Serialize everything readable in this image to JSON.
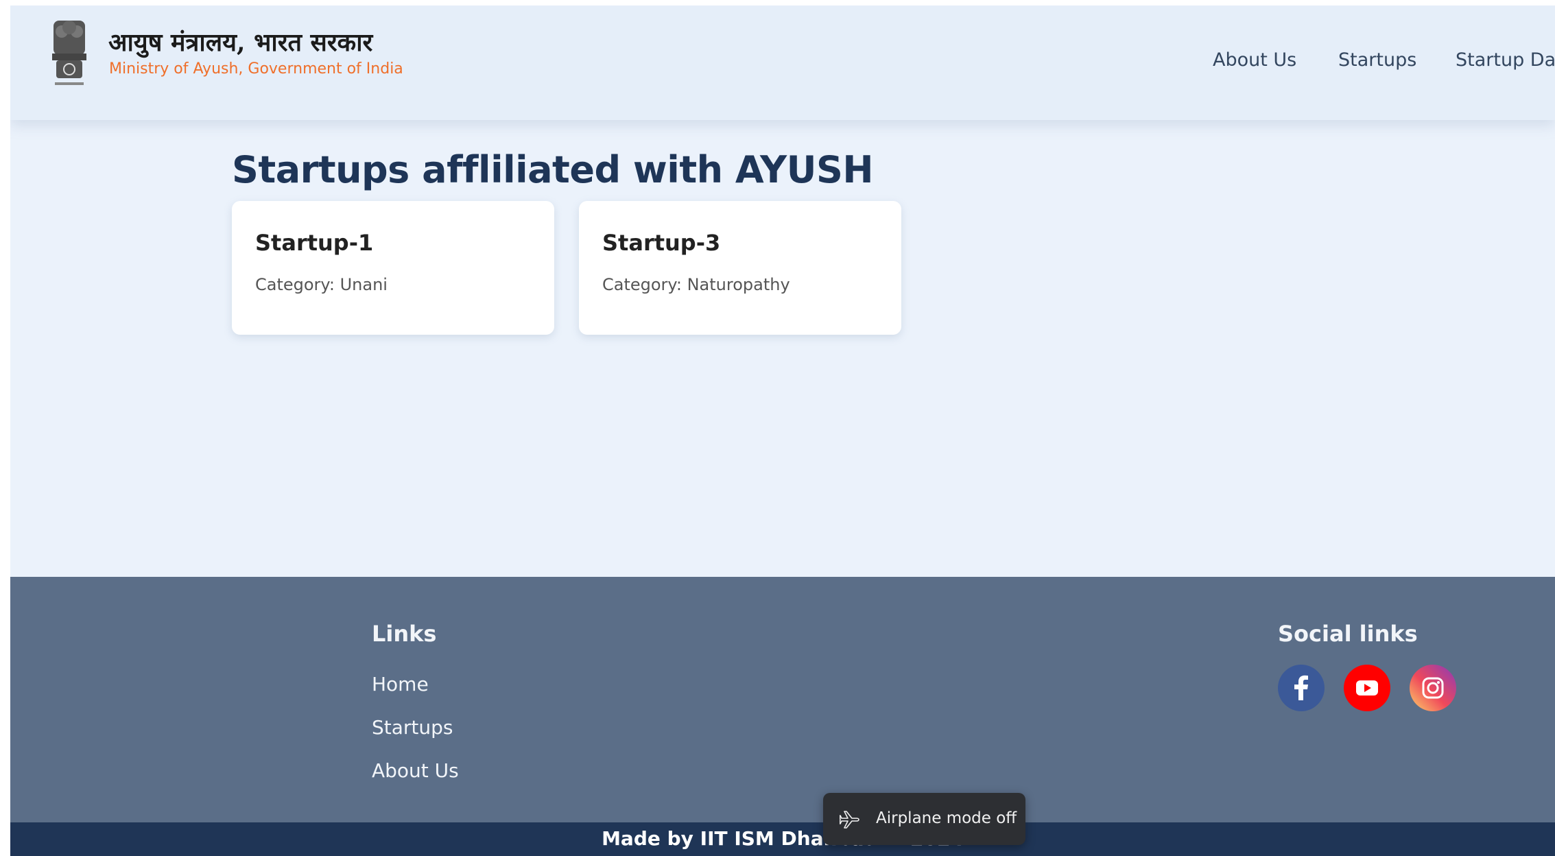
{
  "header": {
    "hindi_title": "आयुष मंत्रालय, भारत सरकार",
    "english_title": "Ministry of Ayush, Government of India",
    "nav": [
      "About Us",
      "Startups",
      "Startup Da"
    ]
  },
  "main": {
    "heading": "Startups affliliated with AYUSH",
    "cards": [
      {
        "title": "Startup-1",
        "category": "Category: Unani"
      },
      {
        "title": "Startup-3",
        "category": "Category: Naturopathy"
      }
    ]
  },
  "footer": {
    "links_heading": "Links",
    "links": [
      "Home",
      "Startups",
      "About Us"
    ],
    "social_heading": "Social links",
    "social": [
      "facebook-icon",
      "youtube-icon",
      "instagram-icon"
    ],
    "copyright": "Made by IIT ISM Dhanbad © 2024"
  },
  "toast": {
    "text": "Airplane mode off"
  },
  "colors": {
    "brand_orange": "#ef6f2a",
    "heading_navy": "#1e3557",
    "footer_bg": "#5b6e88",
    "bottom_bar": "#1f3556",
    "facebook": "#3b5998",
    "youtube": "#ff0000"
  }
}
